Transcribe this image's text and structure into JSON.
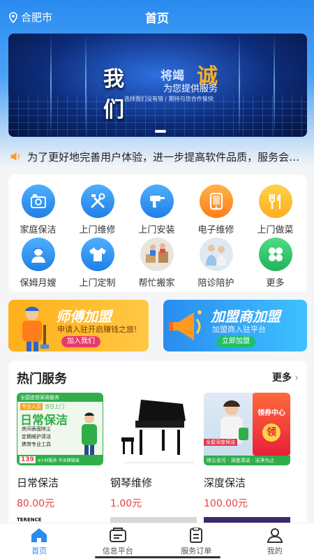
{
  "header": {
    "location": "合肥市",
    "title": "首页"
  },
  "banner": {
    "headline": "我们",
    "headline2": "将竭",
    "highlight": "诚",
    "subtitle": "为您提供服务",
    "tagline": "选择我们没有错 / 期待与您合作愉快"
  },
  "notice": {
    "text": "为了更好地完善用户体验，进一步提高软件品质，服务会不断升级优化"
  },
  "services": [
    {
      "label": "家庭保洁",
      "icon": "house-cleaning-icon"
    },
    {
      "label": "上门维修",
      "icon": "repair-tools-icon"
    },
    {
      "label": "上门安装",
      "icon": "drill-icon"
    },
    {
      "label": "电子维修",
      "icon": "tablet-icon"
    },
    {
      "label": "上门做菜",
      "icon": "cooking-icon"
    },
    {
      "label": "保姆月嫂",
      "icon": "nanny-icon"
    },
    {
      "label": "上门定制",
      "icon": "tshirt-icon"
    },
    {
      "label": "帮忙搬家",
      "icon": "moving-photo"
    },
    {
      "label": "陪诊陪护",
      "icon": "escort-photo"
    },
    {
      "label": "更多",
      "icon": "more-grid-icon"
    }
  ],
  "promos": [
    {
      "title": "师傅加盟",
      "subtitle": "申请入驻开启赚钱之旅!",
      "button": "加入我们"
    },
    {
      "title": "加盟商加盟",
      "subtitle": "加盟商入驻平台",
      "button": "立即加盟"
    }
  ],
  "hot": {
    "title": "热门服务",
    "more": "更多",
    "items": [
      {
        "name": "日常保洁",
        "price": "80.00元",
        "img_title": "日常保洁",
        "img_tags": [
          "专业人员",
          "当日上门"
        ],
        "img_lines": [
          "房间表面除尘",
          "定期维护清洁",
          "携带专业工具"
        ],
        "img_price": "139",
        "img_foot": "4小时服务 不含擦玻璃",
        "img_badge": "全国连锁家政服务"
      },
      {
        "name": "钢琴维修",
        "price": "1.00元"
      },
      {
        "name": "深度保洁",
        "price": "100.00元",
        "img_badge": "全屋深度保洁",
        "img_foot": "除尘去污 · 深度清洁 · 洁净为止",
        "coupon_title": "领券中心",
        "coupon_btn": "领"
      }
    ],
    "next_row_text": "TERENCE"
  },
  "tabbar": [
    {
      "label": "首页",
      "active": true
    },
    {
      "label": "信息平台",
      "active": false
    },
    {
      "label": "服务订单",
      "active": false
    },
    {
      "label": "我的",
      "active": false
    }
  ],
  "colors": {
    "primary": "#2a8cf0",
    "price": "#e64040"
  }
}
